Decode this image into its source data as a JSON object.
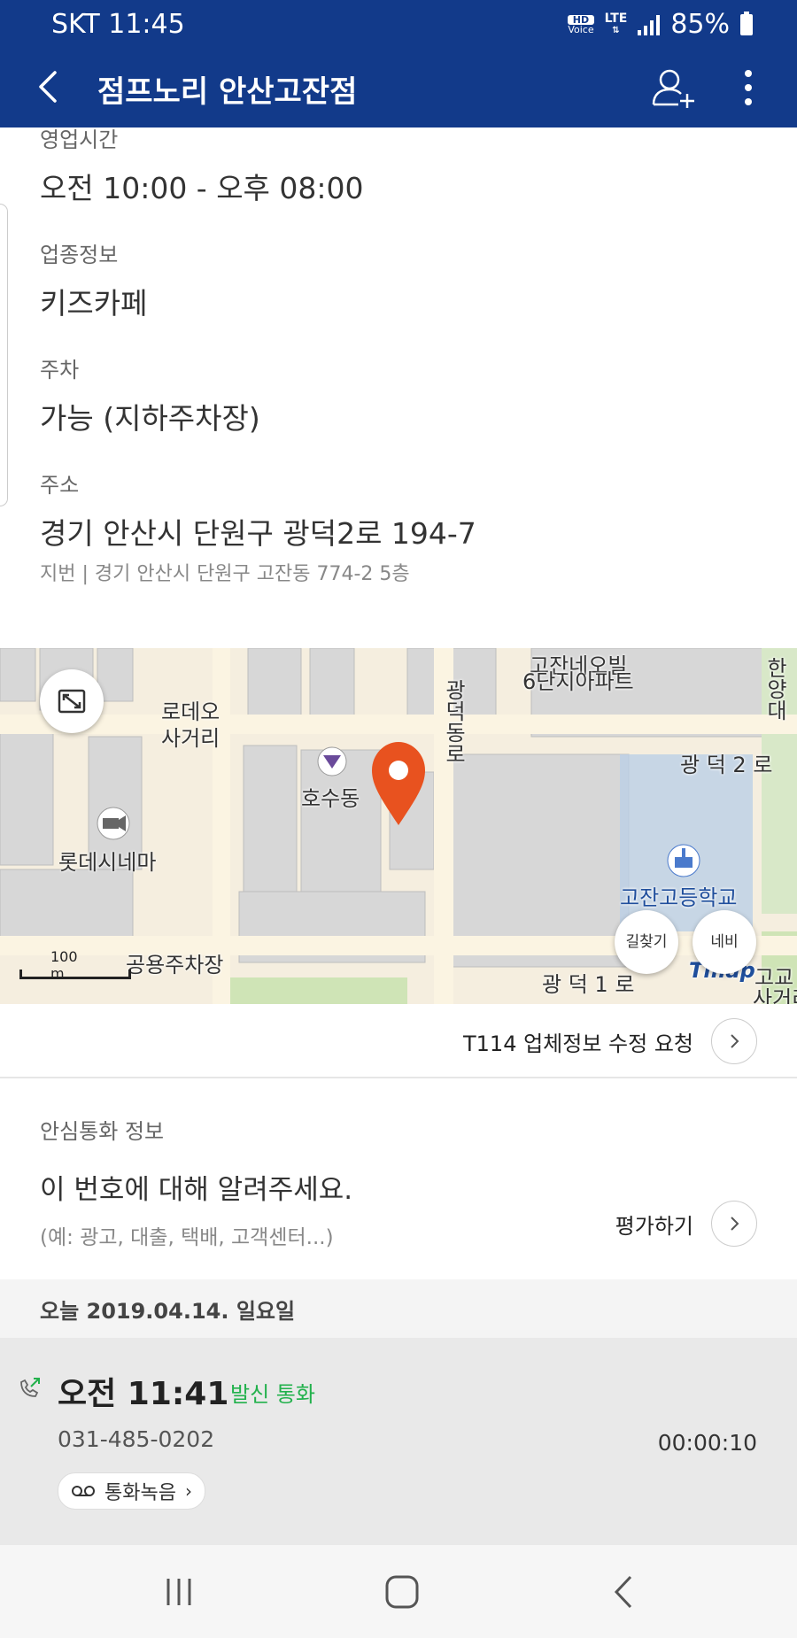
{
  "status": {
    "carrier_time": "SKT 11:45",
    "hd_label": "HD",
    "voice_label": "Voice",
    "lte_label": "LTE",
    "battery": "85%"
  },
  "header": {
    "title": "점프노리 안산고잔점"
  },
  "info": {
    "hours_label": "영업시간",
    "hours_value": "오전 10:00 - 오후 08:00",
    "category_label": "업종정보",
    "category_value": "키즈카페",
    "parking_label": "주차",
    "parking_value": "가능 (지하주차장)",
    "address_label": "주소",
    "address_value": "경기 안산시 단원구 광덕2로 194-7",
    "jibun_value": "지번 | 경기 안산시 단원구 고잔동 774-2 5층"
  },
  "map": {
    "labels": {
      "apartment_1": "고잔네오빌",
      "apartment_2": "6단지아파트",
      "intersection_1": "로데오",
      "intersection_2": "사거리",
      "road_vertical": "광덕동로",
      "road_right": "광 덕 2 로",
      "road_bottom": "광 덕 1 로",
      "hosu": "호수동",
      "cinema": "롯데시네마",
      "school": "고잔고등학교",
      "parking": "공용주차장",
      "corner_right_1": "고교",
      "corner_right_2": "사거리",
      "road_far_right": "한양대",
      "tmap": "Tmap"
    },
    "scale": "100 m",
    "route_label": "길찾기",
    "navi_label": "네비"
  },
  "edit_request": {
    "label": "T114 업체정보 수정 요청"
  },
  "safe_call": {
    "section_label": "안심통화 정보",
    "prompt": "이 번호에 대해 알려주세요.",
    "example": "(예: 광고, 대출, 택배, 고객센터...)",
    "rate_label": "평가하기"
  },
  "call_log": {
    "date": "오늘 2019.04.14. 일요일",
    "time": "오전 11:41",
    "type": "발신 통화",
    "number": "031-485-0202",
    "duration": "00:00:10",
    "record_label": "통화녹음",
    "type_color": "#22b14c"
  },
  "colors": {
    "primary": "#123a8a",
    "pin": "#e8521f"
  }
}
